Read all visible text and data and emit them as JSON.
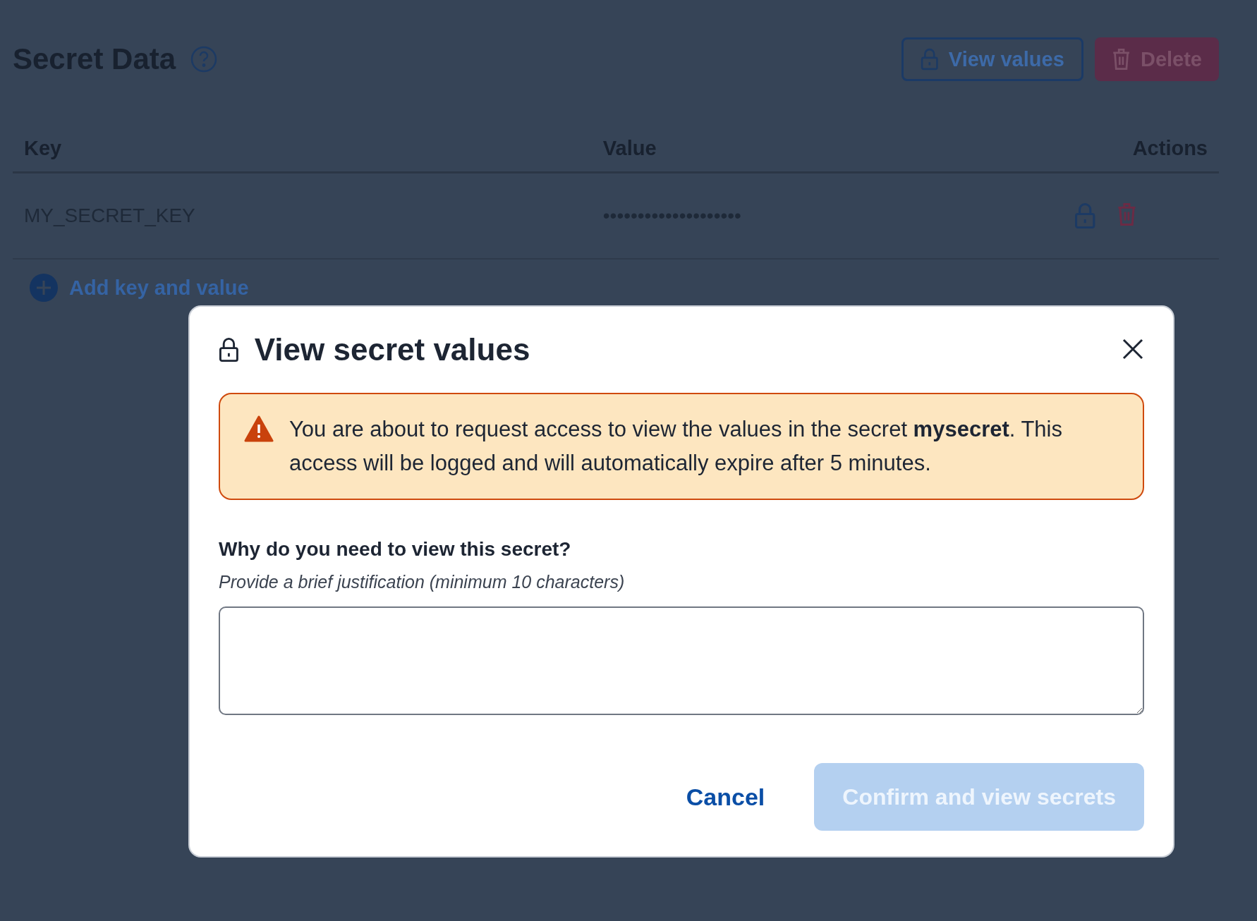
{
  "header": {
    "title": "Secret Data",
    "buttons": [
      {
        "kind": "outline",
        "label": "View values"
      },
      {
        "kind": "danger",
        "label": "Delete"
      }
    ]
  },
  "table": {
    "columns": [
      "Key",
      "Value",
      "Actions"
    ],
    "rows": [
      {
        "key": "MY_SECRET_KEY",
        "value": "••••••••••••••••••••"
      }
    ]
  },
  "add_button": {
    "label": "Add key and value"
  },
  "dialog": {
    "title": "View secret values",
    "alert": {
      "text": "You are about to request access to view the values in the secret **mysecret**. This access will be logged and will automatically expire after 5 minutes."
    },
    "question": "Why do you need to view this secret?",
    "hint": "Provide a brief justification (minimum 10 characters)",
    "buttons": [
      {
        "kind": "link",
        "label": "Cancel"
      },
      {
        "kind": "primary",
        "label": "Confirm and view secrets",
        "disabled": true
      }
    ]
  }
}
